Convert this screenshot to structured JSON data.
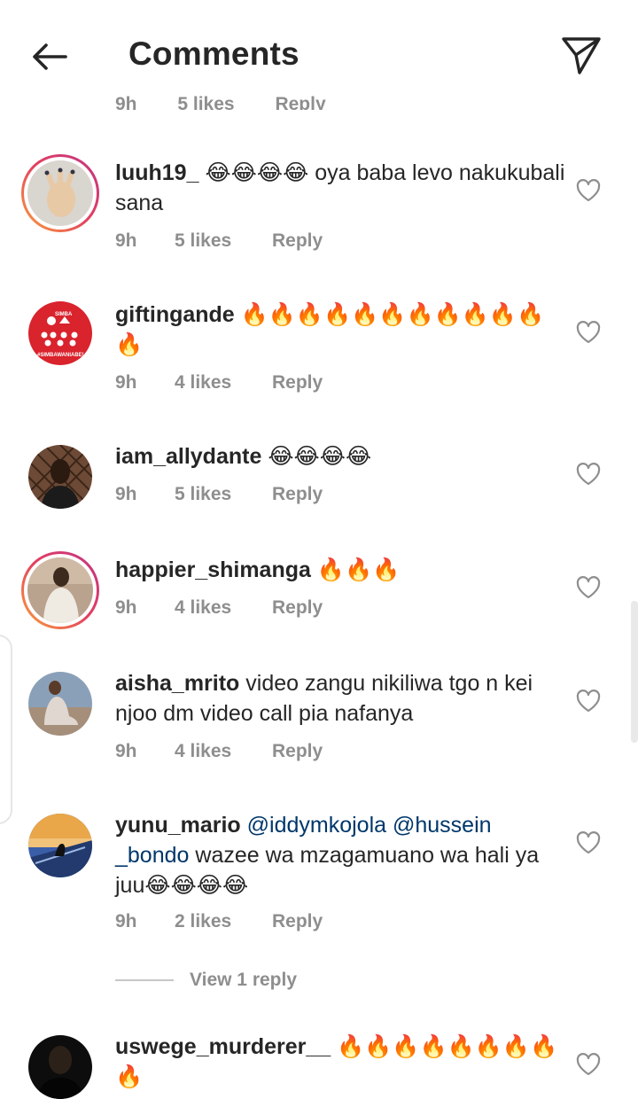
{
  "header": {
    "title": "Comments"
  },
  "partial_row": {
    "time": "9h",
    "likes": "5 likes",
    "reply": "Reply"
  },
  "comments": [
    {
      "username": "luuh19_",
      "text": "😂😂😂😂 oya baba levo nakukubali sana",
      "time": "9h",
      "likes": "5 likes",
      "reply": "Reply",
      "avatar": "hand-with-nails-avatar"
    },
    {
      "username": "giftingande",
      "text": "🔥🔥🔥🔥🔥🔥🔥🔥🔥🔥🔥🔥",
      "time": "9h",
      "likes": "4 likes",
      "reply": "Reply",
      "avatar": "simba-logo-avatar",
      "avatar_logo_text": "#SIMBAWANIABE!",
      "avatar_logo_top": "SIMBA"
    },
    {
      "username": "iam_allydante",
      "text": "😂😂😂😂",
      "time": "9h",
      "likes": "5 likes",
      "reply": "Reply",
      "avatar": "person-dark-avatar"
    },
    {
      "username": "happier_shimanga",
      "text": "🔥🔥🔥",
      "time": "9h",
      "likes": "4 likes",
      "reply": "Reply",
      "avatar": "person-white-outfit-avatar"
    },
    {
      "username": "aisha_mrito",
      "text": "video zangu nikiliwa tgo n kei njoo dm video call pia nafanya",
      "time": "9h",
      "likes": "4 likes",
      "reply": "Reply",
      "avatar": "woman-sitting-avatar"
    },
    {
      "username": "yunu_mario",
      "mention1": "@iddymkojola",
      "mention2": "@hussein _bondo",
      "text": "wazee wa mzagamuano wa hali ya juu😂😂😂😂",
      "time": "9h",
      "likes": "2 likes",
      "reply": "Reply",
      "avatar": "person-sunset-avatar",
      "view_replies": "View 1 reply"
    },
    {
      "username": "uswege_murderer__",
      "text": "🔥🔥🔥🔥🔥🔥🔥🔥🔥",
      "avatar": "person-black-shirt-avatar"
    }
  ],
  "colors": {
    "text": "#262626",
    "meta": "#8e8e8e",
    "mention": "#00376b",
    "story_ring_start": "#f9a23a",
    "story_ring_end": "#c13584"
  }
}
